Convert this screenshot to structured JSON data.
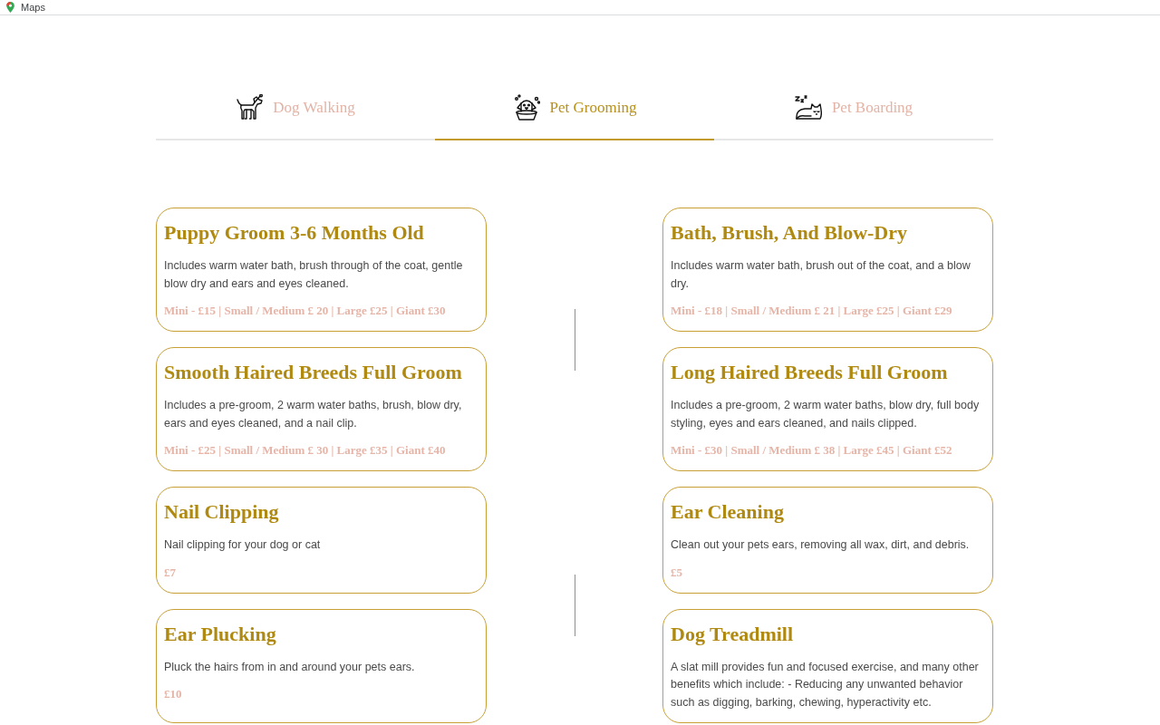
{
  "bookmarks_bar": {
    "items": [
      {
        "label": "Maps"
      }
    ]
  },
  "tabs": [
    {
      "label": "Dog Walking",
      "kind": "walking",
      "selected": false
    },
    {
      "label": "Pet Grooming",
      "kind": "grooming",
      "selected": true
    },
    {
      "label": "Pet Boarding",
      "kind": "boarding",
      "selected": false
    }
  ],
  "services": [
    {
      "title": "Puppy Groom 3-6 Months Old",
      "description": "Includes warm water bath, brush through of the coat, gentle blow dry and ears and eyes cleaned.",
      "price": "Mini - £15 | Small / Medium £ 20 | Large £25 | Giant £30"
    },
    {
      "title": "Bath, Brush, And Blow-Dry",
      "description": "Includes warm water bath, brush out of the coat, and a blow dry.",
      "price": "Mini - £18 | Small / Medium £ 21 | Large £25 | Giant £29"
    },
    {
      "title": "Smooth Haired Breeds Full Groom",
      "description": "Includes a pre-groom, 2 warm water baths, brush, blow dry, ears and eyes cleaned, and a nail clip.",
      "price": "Mini - £25 | Small / Medium £ 30 | Large £35 | Giant £40"
    },
    {
      "title": "Long Haired Breeds Full Groom",
      "description": "Includes a pre-groom, 2 warm water baths, blow dry, full body styling, eyes and ears cleaned, and nails clipped.",
      "price": "Mini - £30 | Small / Medium £ 38 | Large £45 | Giant £52"
    },
    {
      "title": "Nail Clipping",
      "description": "Nail clipping for your dog or cat",
      "price": "£7"
    },
    {
      "title": "Ear Cleaning",
      "description": "Clean out your pets ears, removing all wax, dirt, and debris.",
      "price": "£5"
    },
    {
      "title": "Ear Plucking",
      "description": "Pluck the hairs from in and around your pets ears.",
      "price": "£10"
    },
    {
      "title": "Dog Treadmill",
      "description": "A slat mill provides fun and focused exercise, and many other benefits which include: - Reducing any unwanted behavior such as digging, barking, chewing, hyperactivity etc."
    }
  ]
}
